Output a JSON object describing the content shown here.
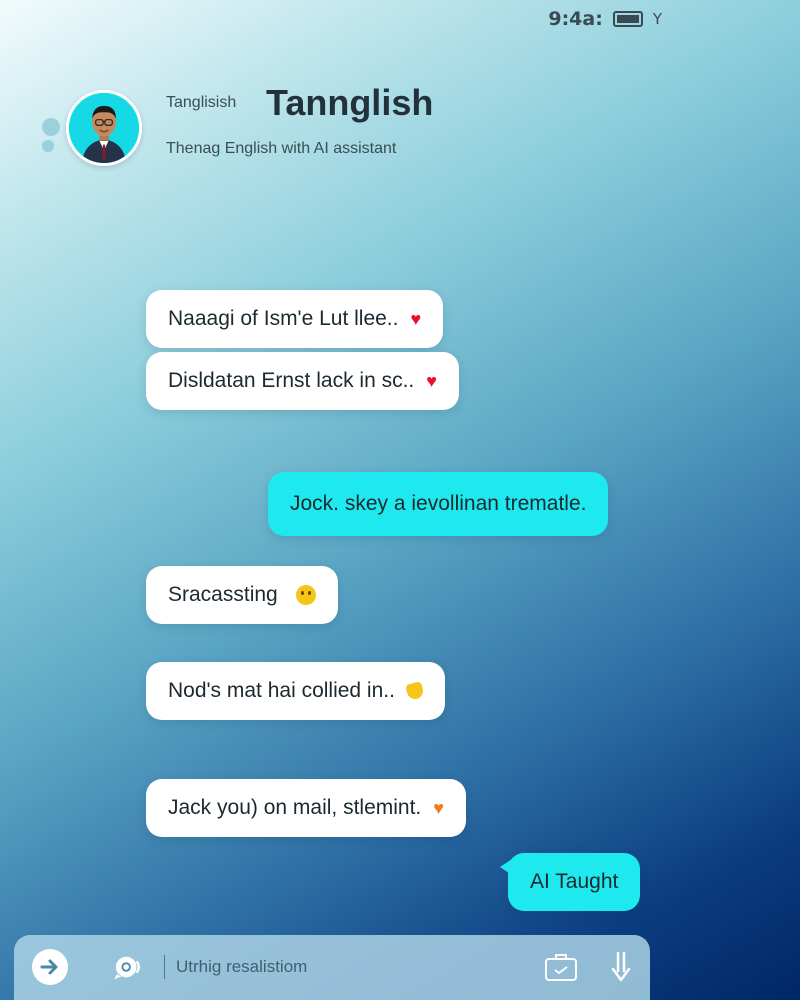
{
  "status_bar": {
    "time": "9:4a:",
    "battery_icon": "battery-icon",
    "signal": "Y"
  },
  "header": {
    "app_name_small": "Tanglisish",
    "title": "Tannglish",
    "subtitle": "Thenag English with AI assistant",
    "avatar_icon": "avatar-person"
  },
  "messages": [
    {
      "text": "Naaagi of Ism'e Lut llee..",
      "direction": "incoming",
      "emoji": "red-heart"
    },
    {
      "text": "Disldatan Ernst lack in sc..",
      "direction": "incoming",
      "emoji": "red-heart"
    },
    {
      "text": "Jock. skey a ievollinan trematle.",
      "direction": "outgoing",
      "emoji": ""
    },
    {
      "text": "Sracassting",
      "direction": "incoming",
      "emoji": "smiling-face"
    },
    {
      "text": "Nod's mat hai collied in..",
      "direction": "incoming",
      "emoji": "yellow-hand"
    },
    {
      "text": "Jack you) on mail, stlemint.",
      "direction": "incoming",
      "emoji": "orange-heart"
    },
    {
      "text": "AI Taught",
      "direction": "outgoing",
      "emoji": ""
    }
  ],
  "composer": {
    "placeholder": "Utrhig resalistiom",
    "send_icon": "arrow-right-icon",
    "voice_icon": "voice-chat-icon",
    "attach_icon": "briefcase-icon",
    "mic_icon": "microphone-icon"
  },
  "colors": {
    "outgoing_bubble": "#1de9ee",
    "incoming_bubble": "#ffffff",
    "gradient_top": "#f2fbfc",
    "gradient_bottom": "#002766"
  }
}
